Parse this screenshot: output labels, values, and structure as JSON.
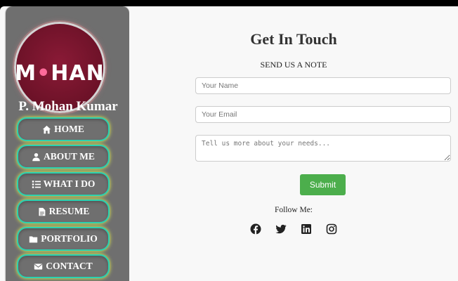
{
  "sidebar": {
    "logo_text_left": "M",
    "logo_text_dot": "•",
    "logo_text_right": "HAN",
    "name": "P. Mohan Kumar",
    "nav": [
      {
        "label": "HOME",
        "icon": "home-icon"
      },
      {
        "label": "ABOUT ME",
        "icon": "user-icon"
      },
      {
        "label": "WHAT I DO",
        "icon": "list-icon"
      },
      {
        "label": "RESUME",
        "icon": "file-icon"
      },
      {
        "label": "PORTFOLIO",
        "icon": "folder-icon"
      },
      {
        "label": "CONTACT",
        "icon": "envelope-icon"
      }
    ]
  },
  "contact": {
    "title": "Get In Touch",
    "subtitle": "SEND US A NOTE",
    "name_placeholder": "Your Name",
    "email_placeholder": "Your Email",
    "message_placeholder": "Tell us more about your needs...",
    "submit_label": "Submit",
    "follow_label": "Follow Me:",
    "socials": [
      "facebook-icon",
      "twitter-icon",
      "linkedin-icon",
      "instagram-icon"
    ]
  },
  "colors": {
    "sidebar_bg": "#6f6f6f",
    "nav_border": "#2bd1b0",
    "nav_glow": "#e7ff4c",
    "submit_bg": "#4cae4c",
    "logo_bg": "#7a1530"
  }
}
